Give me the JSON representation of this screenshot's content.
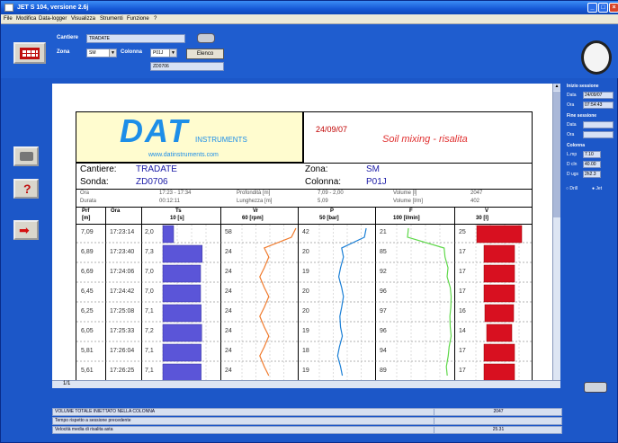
{
  "window": {
    "title": "JET S 104, versione 2.6j"
  },
  "menu": [
    "File",
    "Modifica",
    "Data-logger",
    "Visualizza",
    "Strumenti",
    "Funzione",
    "?"
  ],
  "topbar": {
    "cantiere_label": "Cantiere",
    "cantiere_value": "TRADATE",
    "zona_label": "Zona",
    "zona_value": "SM",
    "colonna_label": "Colonna",
    "colonna_value": "P01J",
    "elenco_button": "Elenco",
    "sonda_value": "ZD0706"
  },
  "rightpanel": {
    "inizio_title": "Inizio sessione",
    "data_label": "Data",
    "data_value": "24/09/07",
    "ora_label": "Ora",
    "ora_value": "07:54:43",
    "fine_title": "Fine sessione",
    "fine_data_label": "Data",
    "fine_ora_label": "Ora",
    "colonna_title": "Colonna",
    "lmp_label": "L.mp",
    "lmp_value": "7.10",
    "dcln_label": "D cln",
    "dcln_value": "40.00",
    "dugs_label": "D ugs",
    "dugs_value": "2h2.3",
    "radio1": "Drill",
    "radio2": "Jet"
  },
  "report": {
    "logo": "DAT",
    "logo_sub": "INSTRUMENTS",
    "website": "www.datinstruments.com",
    "date": "24/09/07",
    "title": "Soil mixing - risalita",
    "cantiere_label": "Cantiere:",
    "cantiere_value": "TRADATE",
    "zona_label": "Zona:",
    "zona_value": "SM",
    "sonda_label": "Sonda:",
    "sonda_value": "ZD0706",
    "colonna_label": "Colonna:",
    "colonna_value": "P01J",
    "ora_label": "Ora",
    "ora_value": "17:23 - 17:34",
    "durata_label": "Durata",
    "durata_value": "00:12:11",
    "profondita_label": "Profondità [m]",
    "profondita_value": "7,09 - 2,00",
    "lunghezza_label": "Lunghezza [m]",
    "lunghezza_value": "5,09",
    "volume_label": "Volume [l]",
    "volume_value": "2047",
    "volumem_label": "Volume [l/m]",
    "volumem_value": "402",
    "col_prf": "Prf",
    "col_prf_unit": "[m]",
    "col_ora": "Ora",
    "col_ts": "Ts",
    "col_ts_unit": "10 [s]",
    "col_vr": "Vr",
    "col_vr_unit": "60 [rpm]",
    "col_p": "P",
    "col_p_unit": "50 [bar]",
    "col_f": "F",
    "col_f_unit": "100 [l/min]",
    "col_v": "V",
    "col_v_unit": "30 [l]",
    "rows": [
      {
        "prf": "7,09",
        "ora": "17:23:14",
        "ts": "2,0",
        "vr": "58",
        "p": "42",
        "f": "21",
        "v": "25"
      },
      {
        "prf": "6,89",
        "ora": "17:23:40",
        "ts": "7,3",
        "vr": "24",
        "p": "20",
        "f": "85",
        "v": "17"
      },
      {
        "prf": "6,69",
        "ora": "17:24:06",
        "ts": "7,0",
        "vr": "24",
        "p": "19",
        "f": "92",
        "v": "17"
      },
      {
        "prf": "6,45",
        "ora": "17:24:42",
        "ts": "7,0",
        "vr": "24",
        "p": "20",
        "f": "96",
        "v": "17"
      },
      {
        "prf": "6,25",
        "ora": "17:25:08",
        "ts": "7,1",
        "vr": "24",
        "p": "20",
        "f": "97",
        "v": "16"
      },
      {
        "prf": "6,05",
        "ora": "17:25:33",
        "ts": "7,2",
        "vr": "24",
        "p": "19",
        "f": "96",
        "v": "14"
      },
      {
        "prf": "5,81",
        "ora": "17:26:04",
        "ts": "7,1",
        "vr": "24",
        "p": "18",
        "f": "94",
        "v": "17"
      },
      {
        "prf": "5,61",
        "ora": "17:26:25",
        "ts": "7,1",
        "vr": "24",
        "p": "19",
        "f": "89",
        "v": "17"
      }
    ]
  },
  "pager": "1/1",
  "bottom": [
    {
      "label": "VOLUME TOTALE INIETTATO NELLA COLONNA",
      "value": "2047"
    },
    {
      "label": "Tempo rispetto a sessione precedente",
      "value": ""
    },
    {
      "label": "Velocità media di risalita asta",
      "value": "25.31"
    }
  ],
  "colors": {
    "ts_bar": "#5b55d8",
    "vr_line": "#f07a2c",
    "p_line": "#1a7fd6",
    "f_line": "#5fd84a",
    "v_bar": "#d81020"
  }
}
